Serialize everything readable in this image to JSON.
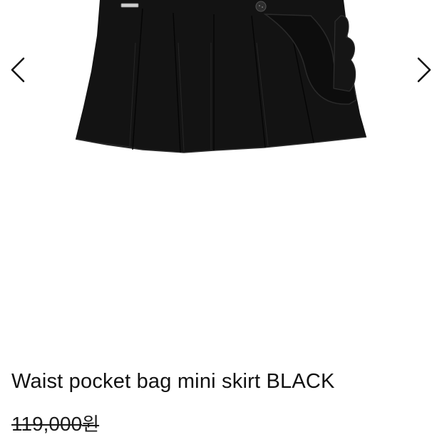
{
  "product": {
    "title": "Waist pocket bag mini skirt BLACK",
    "original_price": "119,000",
    "currency": "원"
  },
  "gallery": {
    "prev_icon": "chevron-left-icon",
    "next_icon": "chevron-right-icon",
    "image_subject": "black pleated mini skirt"
  },
  "colors": {
    "background": "#ffffff",
    "text": "#111111",
    "skirt": "#131313"
  }
}
